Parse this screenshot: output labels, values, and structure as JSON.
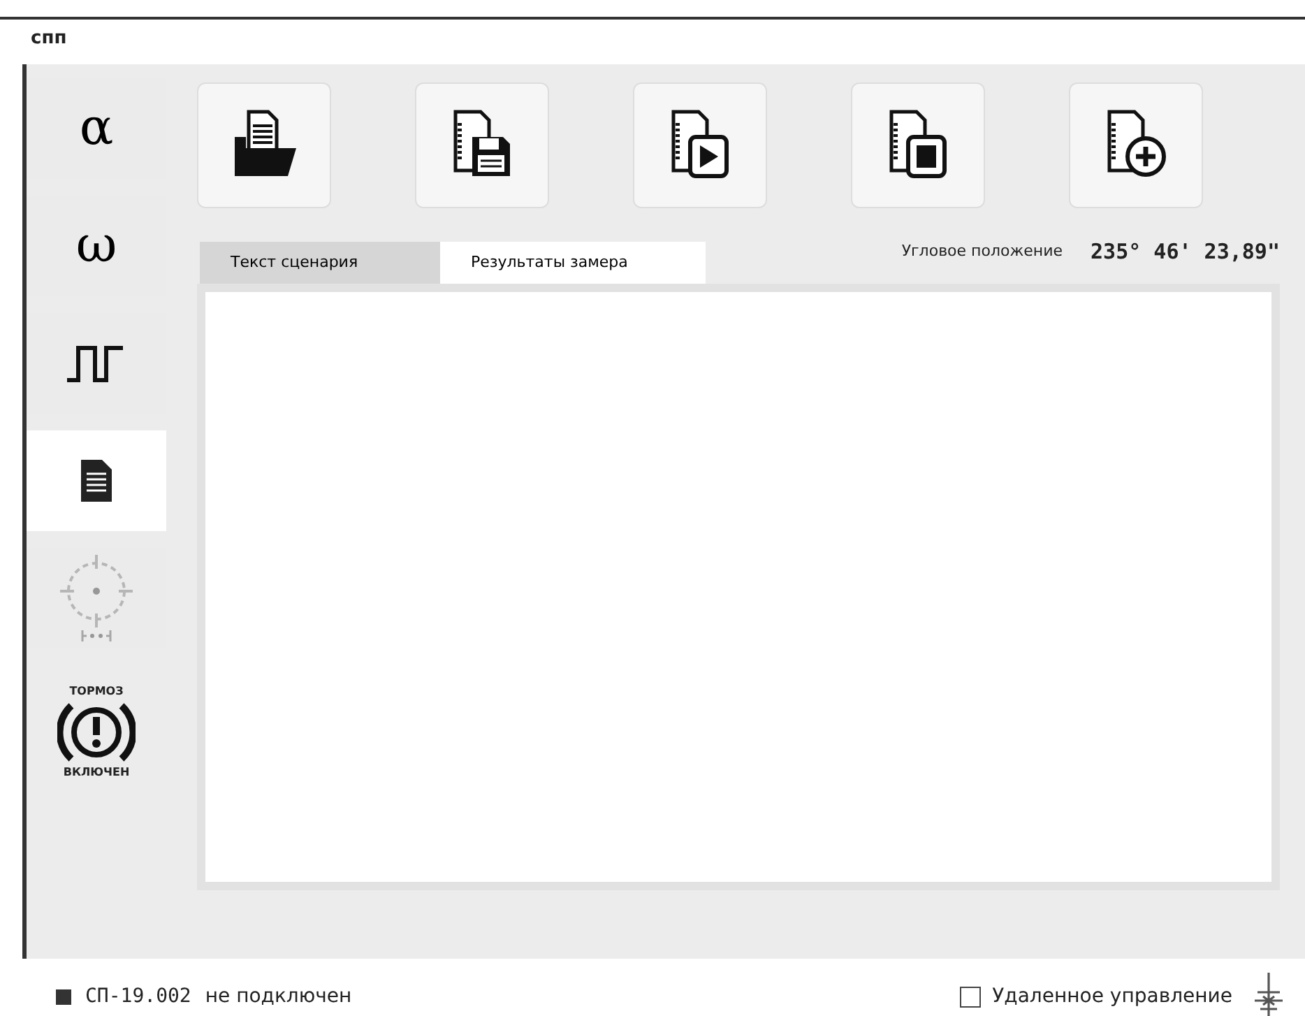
{
  "window": {
    "title": "спп"
  },
  "sidebar": {
    "items": [
      {
        "kind": "glyph",
        "label": "α",
        "selected": false,
        "disabled": false
      },
      {
        "kind": "glyph",
        "label": "ω",
        "selected": false,
        "disabled": false
      },
      {
        "kind": "pulse",
        "selected": false,
        "disabled": false
      },
      {
        "kind": "document",
        "selected": true,
        "disabled": false
      },
      {
        "kind": "target",
        "selected": false,
        "disabled": true
      },
      {
        "kind": "brake",
        "top_text": "ТОРМОЗ",
        "bottom_text": "ВКЛЮЧЕН"
      }
    ]
  },
  "toolbar": [
    {
      "kind": "open"
    },
    {
      "kind": "save"
    },
    {
      "kind": "play"
    },
    {
      "kind": "stop"
    },
    {
      "kind": "add"
    }
  ],
  "tabs": [
    {
      "label": "Текст сценария",
      "selected": false
    },
    {
      "label": "Результаты замера",
      "selected": true
    }
  ],
  "angle": {
    "label": "Угловое положение",
    "value": "235° 46' 23,89\""
  },
  "status_bar": {
    "connected": false,
    "device": "СП-19.002",
    "status": "не подключен",
    "remote": {
      "label": "Удаленное управление",
      "checked": false
    }
  }
}
